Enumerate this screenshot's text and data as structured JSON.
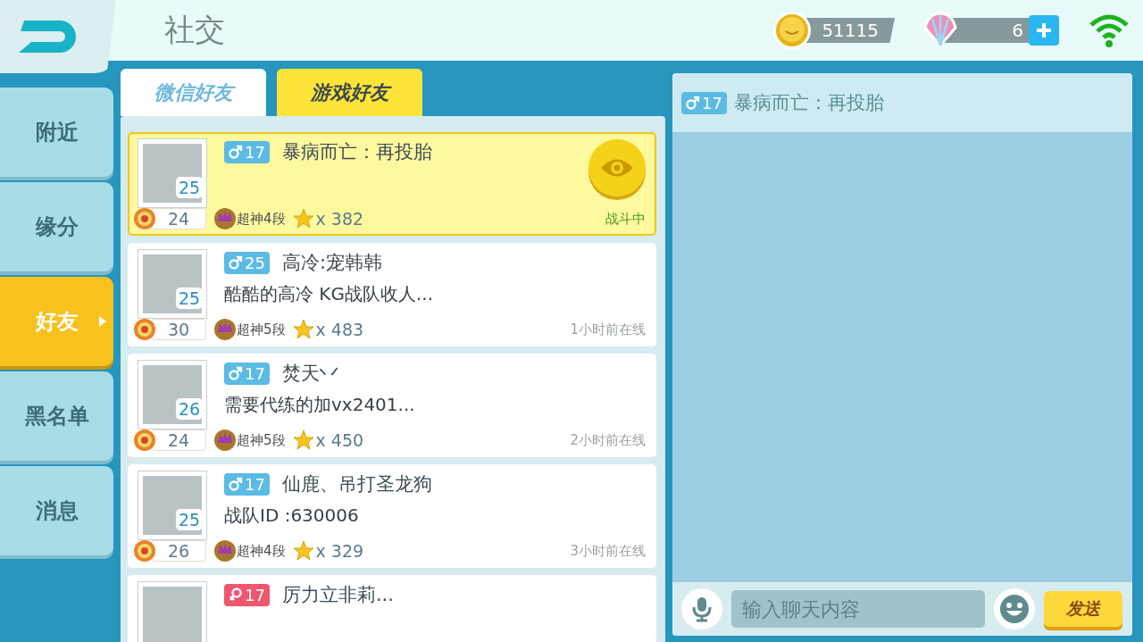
{
  "header": {
    "title": "社交",
    "coins": "51115",
    "shells": "6"
  },
  "nav": [
    {
      "label": "附近",
      "selected": false
    },
    {
      "label": "缘分",
      "selected": false
    },
    {
      "label": "好友",
      "selected": true
    },
    {
      "label": "黑名单",
      "selected": false
    },
    {
      "label": "消息",
      "selected": false
    }
  ],
  "tabs": [
    {
      "label": "微信好友",
      "selected": false
    },
    {
      "label": "游戏好友",
      "selected": true
    }
  ],
  "friends": [
    {
      "selected": true,
      "badge": {
        "kind": "male",
        "age": "17"
      },
      "name": "暴病而亡：再投胎",
      "avatar_level": "25",
      "rank_level": "24",
      "tier": "超神4段",
      "star_count": "x 382",
      "status": {
        "kind": "battle",
        "text": "战斗中"
      }
    },
    {
      "selected": false,
      "badge": {
        "kind": "male",
        "age": "25"
      },
      "name": "高冷:宠韩韩",
      "signature": "酷酷的高冷 KG战队收人...",
      "avatar_level": "25",
      "rank_level": "30",
      "tier": "超神5段",
      "star_count": "x 483",
      "status": {
        "kind": "offline",
        "text": "1小时前在线"
      }
    },
    {
      "selected": false,
      "badge": {
        "kind": "male",
        "age": "17"
      },
      "name": "焚天丷",
      "signature": "需要代练的加vx2401...",
      "avatar_level": "26",
      "rank_level": "24",
      "tier": "超神5段",
      "star_count": "x 450",
      "status": {
        "kind": "offline",
        "text": "2小时前在线"
      }
    },
    {
      "selected": false,
      "badge": {
        "kind": "male",
        "age": "17"
      },
      "name": "仙鹿、吊打圣龙狗",
      "signature": "战队ID :630006",
      "avatar_level": "25",
      "rank_level": "26",
      "tier": "超神4段",
      "star_count": "x 329",
      "status": {
        "kind": "offline",
        "text": "3小时前在线"
      }
    },
    {
      "selected": false,
      "badge": {
        "kind": "female",
        "age": "17"
      },
      "name": "厉力立非莉..."
    }
  ],
  "chat": {
    "badge": {
      "kind": "male",
      "age": "17"
    },
    "name": "暴病而亡：再投胎",
    "input_placeholder": "输入聊天内容",
    "send": "发送"
  }
}
